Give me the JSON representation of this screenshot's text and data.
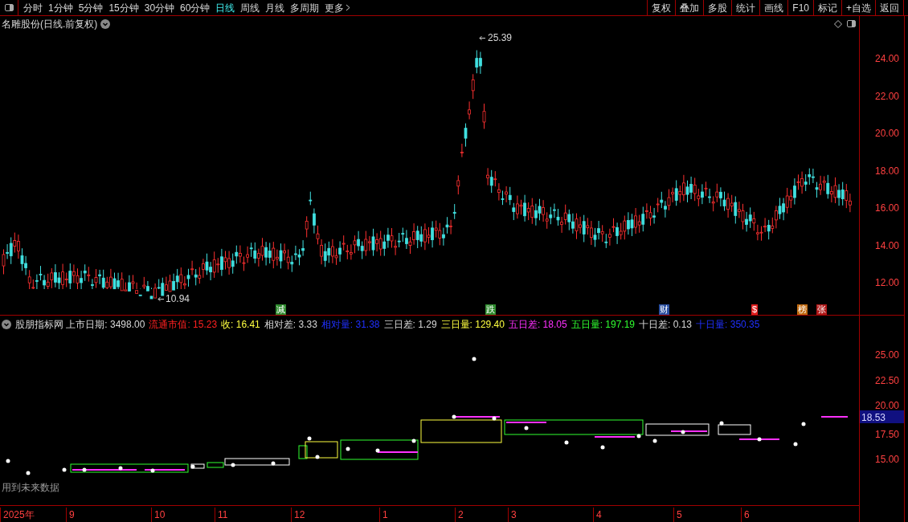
{
  "toolbar": {
    "periods": [
      {
        "label": "分时",
        "selected": false
      },
      {
        "label": "1分钟",
        "selected": false
      },
      {
        "label": "5分钟",
        "selected": false
      },
      {
        "label": "15分钟",
        "selected": false
      },
      {
        "label": "30分钟",
        "selected": false
      },
      {
        "label": "60分钟",
        "selected": false
      },
      {
        "label": "日线",
        "selected": true
      },
      {
        "label": "周线",
        "selected": false
      },
      {
        "label": "月线",
        "selected": false
      },
      {
        "label": "多周期",
        "selected": false
      },
      {
        "label": "更多",
        "selected": false
      }
    ],
    "buttons": [
      "复权",
      "叠加",
      "多股",
      "统计",
      "画线",
      "F10",
      "标记",
      "+自选",
      "返回"
    ]
  },
  "main_chart": {
    "title": "名雕股份(日线.前复权)",
    "high_label": "25.39",
    "low_label": "10.94",
    "signals": [
      {
        "label": "减",
        "color": "#2e8b2e"
      },
      {
        "label": "跌",
        "color": "#2e8b2e"
      },
      {
        "label": "财",
        "color": "#2a4fa0"
      },
      {
        "label": "$",
        "color": "#e02020"
      },
      {
        "label": "榜",
        "color": "#c06a10"
      },
      {
        "label": "张",
        "color": "#b01818"
      }
    ],
    "y_ticks": [
      "24.00",
      "22.00",
      "20.00",
      "18.00",
      "16.00",
      "14.00",
      "12.00"
    ]
  },
  "indicator": {
    "legend": [
      {
        "text": "股朋指标网 上市日期: 3498.00",
        "color": "#d8d8d8"
      },
      {
        "text": "流通市值: 15.23",
        "color": "#ff2020"
      },
      {
        "text": "收: 16.41",
        "color": "#ffff40"
      },
      {
        "text": "相对差: 3.33",
        "color": "#d8d8d8"
      },
      {
        "text": "相对量: 31.38",
        "color": "#2030ff"
      },
      {
        "text": "三日差: 1.29",
        "color": "#d8d8d8"
      },
      {
        "text": "三日量: 129.40",
        "color": "#ffff40"
      },
      {
        "text": "五日差: 18.05",
        "color": "#ff30ff"
      },
      {
        "text": "五日量: 197.19",
        "color": "#30ff30"
      },
      {
        "text": "十日差: 0.13",
        "color": "#d8d8d8"
      },
      {
        "text": "十日量: 350.35",
        "color": "#2030ff"
      }
    ],
    "warning": "用到未来数据",
    "current_value": "18.53",
    "y_ticks": [
      "25.00",
      "22.50",
      "20.00",
      "17.50",
      "15.00"
    ]
  },
  "time_axis": [
    "2025年",
    "9",
    "10",
    "11",
    "12",
    "1",
    "2",
    "3",
    "4",
    "5",
    "6"
  ]
}
